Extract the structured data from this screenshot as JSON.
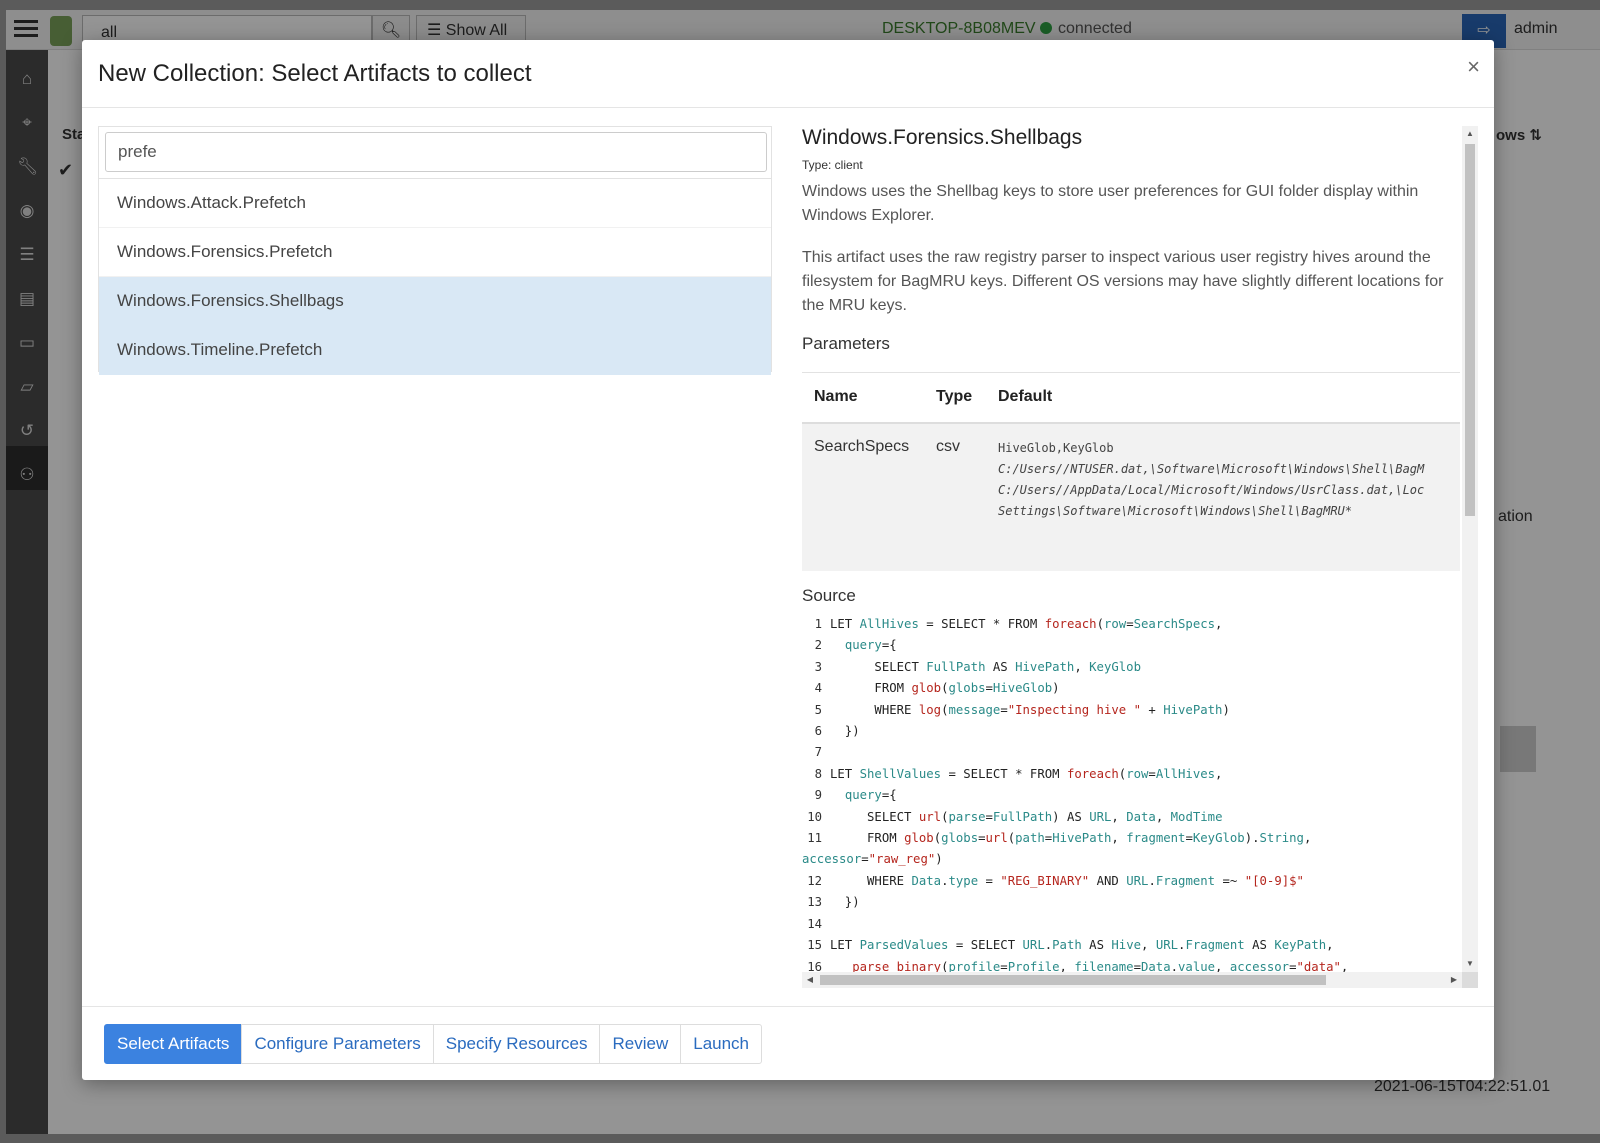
{
  "background": {
    "search_value": "all",
    "show_all_label": "Show All",
    "hostname": "DESKTOP-8B08MEV",
    "connection_status": "connected",
    "user": "admin",
    "column_state_partial": "Sta",
    "column_rows_partial": "ows",
    "partial_text_ation": "ation",
    "timestamp": "2021-06-15T04:22:51.01"
  },
  "modal": {
    "title": "New Collection: Select Artifacts to collect",
    "close_label": "×",
    "search": {
      "value": "prefe",
      "placeholder": ""
    },
    "artifacts": [
      {
        "name": "Windows.Attack.Prefetch",
        "selected": false
      },
      {
        "name": "Windows.Forensics.Prefetch",
        "selected": false
      },
      {
        "name": "Windows.Forensics.Shellbags",
        "selected": true
      },
      {
        "name": "Windows.Timeline.Prefetch",
        "selected": true
      }
    ],
    "detail": {
      "name": "Windows.Forensics.Shellbags",
      "type_label": "Type: client",
      "description_1": "Windows uses the Shellbag keys to store user preferences for GUI folder display within Windows Explorer.",
      "description_2": "This artifact uses the raw registry parser to inspect various user registry hives around the filesystem for BagMRU keys. Different OS versions may have slightly different locations for the MRU keys.",
      "parameters_title": "Parameters",
      "param_headers": [
        "Name",
        "Type",
        "Default"
      ],
      "params": [
        {
          "name": "SearchSpecs",
          "type": "csv",
          "default_lines": [
            "HiveGlob,KeyGlob",
            "C:/Users//NTUSER.dat,\\Software\\Microsoft\\Windows\\Shell\\BagM",
            "C:/Users//AppData/Local/Microsoft/Windows/UsrClass.dat,\\Loc",
            "Settings\\Software\\Microsoft\\Windows\\Shell\\BagMRU*"
          ]
        }
      ],
      "source_title": "Source"
    },
    "tabs": [
      {
        "label": "Select Artifacts",
        "active": true
      },
      {
        "label": "Configure Parameters",
        "active": false
      },
      {
        "label": "Specify Resources",
        "active": false
      },
      {
        "label": "Review",
        "active": false
      },
      {
        "label": "Launch",
        "active": false
      }
    ]
  },
  "colors": {
    "accent": "#3b82e0",
    "link": "#2a6bbf",
    "selected_row": "#d9e8f5",
    "code_function": "#b5261e",
    "code_variable": "#2a8a88",
    "connected_dot": "#2ea043"
  },
  "icons": [
    "hamburger-icon",
    "home-icon",
    "crosshair-icon",
    "wrench-icon",
    "eye-icon",
    "server-icon",
    "book-icon",
    "laptop-icon",
    "folder-icon",
    "history-icon",
    "binoculars-icon",
    "search-icon",
    "list-icon",
    "logout-icon",
    "check-icon",
    "close-icon",
    "sort-icon"
  ]
}
